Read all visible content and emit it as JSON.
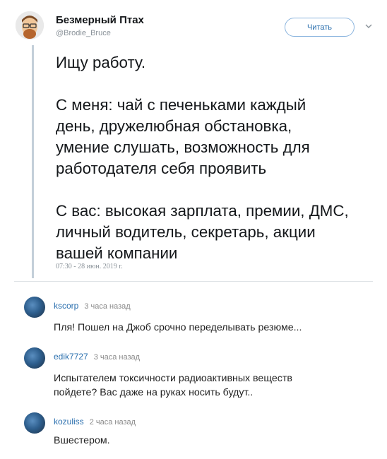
{
  "tweet": {
    "display_name": "Безмерный Птах",
    "handle": "@Brodie_Bruce",
    "follow_label": "Читать",
    "paragraphs": [
      [
        "Ищу работу."
      ],
      [
        "С меня: чай с печеньками каждый",
        "день, дружелюбная обстановка,",
        "умение слушать, возможность для",
        "работодателя себя проявить"
      ],
      [
        "С вас: высокая зарплата, премии, ДМС,",
        "личный водитель, секретарь, акции",
        "вашей компании"
      ]
    ],
    "timestamp": "07:30 - 28 июн. 2019 г."
  },
  "comments": [
    {
      "user": "kscorp",
      "time": "3 часа назад",
      "lines": [
        "Пля! Пошел на Джоб срочно переделывать резюме..."
      ]
    },
    {
      "user": "edik7727",
      "time": "3 часа назад",
      "lines": [
        "Испытателем токсичности радиоактивных веществ",
        "пойдете? Вас даже на руках носить будут.."
      ]
    },
    {
      "user": "kozuliss",
      "time": "2 часа назад",
      "lines": [
        "Вшестером."
      ]
    }
  ]
}
